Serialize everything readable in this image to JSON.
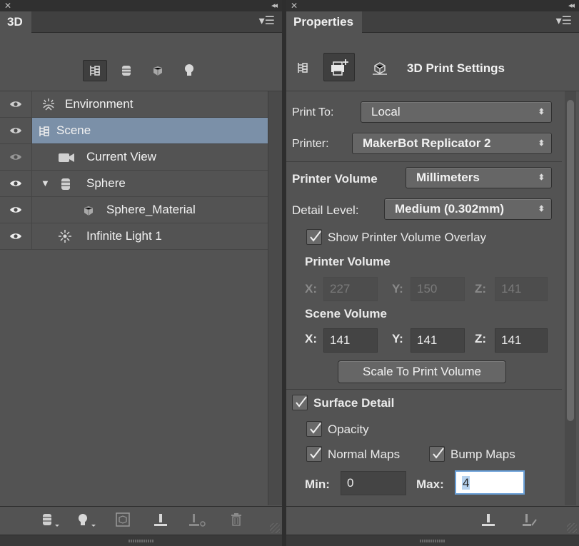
{
  "panel_3d": {
    "tab_title": "3D",
    "layers": [
      {
        "label": "Environment",
        "icon": "environment-icon",
        "visible": true,
        "selected": false
      },
      {
        "label": "Scene",
        "icon": "scene-icon",
        "visible": true,
        "selected": true
      },
      {
        "label": "Current View",
        "icon": "camera-icon",
        "visible": true,
        "selected": false
      },
      {
        "label": "Sphere",
        "icon": "mesh-icon",
        "visible": true,
        "selected": false,
        "expanded": true
      },
      {
        "label": "Sphere_Material",
        "icon": "material-icon",
        "visible": true,
        "selected": false
      },
      {
        "label": "Infinite Light 1",
        "icon": "light-icon",
        "visible": true,
        "selected": false
      }
    ]
  },
  "properties": {
    "tab_title": "Properties",
    "section_title": "3D Print Settings",
    "print_to_label": "Print To:",
    "print_to_value": "Local",
    "printer_label": "Printer:",
    "printer_value": "MakerBot Replicator 2",
    "printer_volume_label": "Printer Volume",
    "printer_volume_unit": "Millimeters",
    "detail_level_label": "Detail Level:",
    "detail_level_value": "Medium (0.302mm)",
    "show_overlay_label": "Show Printer Volume Overlay",
    "printer_volume_heading": "Printer Volume",
    "printer_volume_x": "227",
    "printer_volume_y": "150",
    "printer_volume_z": "141",
    "scene_volume_heading": "Scene Volume",
    "scene_volume_x": "141",
    "scene_volume_y": "141",
    "scene_volume_z": "141",
    "axis_x": "X:",
    "axis_y": "Y:",
    "axis_z": "Z:",
    "scale_button": "Scale To Print Volume",
    "surface_detail_label": "Surface Detail",
    "opacity_label": "Opacity",
    "normal_maps_label": "Normal Maps",
    "bump_maps_label": "Bump Maps",
    "min_label": "Min:",
    "min_value": "0",
    "max_label": "Max:",
    "max_value": "4"
  },
  "colors": {
    "panel_bg": "#535353",
    "selection": "#7b90a8",
    "focus_border": "#6aa0d8"
  }
}
